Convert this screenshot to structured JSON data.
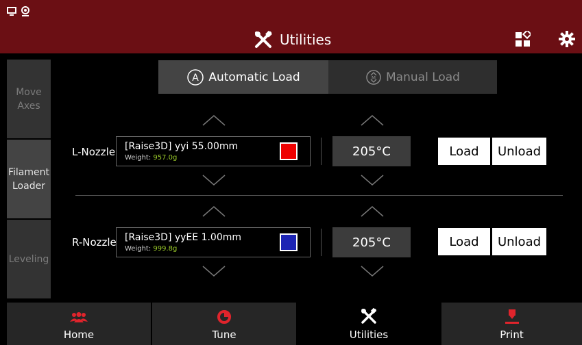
{
  "header": {
    "title": "Utilities"
  },
  "sidebar": {
    "items": [
      {
        "label": "Move\nAxes",
        "active": false
      },
      {
        "label": "Filament\nLoader",
        "active": true
      },
      {
        "label": "Leveling",
        "active": false
      }
    ]
  },
  "tabs": {
    "automatic": "Automatic Load",
    "manual": "Manual Load",
    "selected": "automatic"
  },
  "nozzles": [
    {
      "label": "L-Nozzle",
      "filament": "[Raise3D] yyi 55.00mm",
      "weight_label": "Weight: ",
      "weight_value": "957.0g",
      "color": "#ee0000",
      "temperature": "205°C",
      "load": "Load",
      "unload": "Unload"
    },
    {
      "label": "R-Nozzle",
      "filament": "[Raise3D] yyEE 1.00mm",
      "weight_label": "Weight: ",
      "weight_value": "999.8g",
      "color": "#1c24b4",
      "temperature": "205°C",
      "load": "Load",
      "unload": "Unload"
    }
  ],
  "bottom_nav": {
    "home": "Home",
    "tune": "Tune",
    "utilities": "Utilities",
    "print": "Print",
    "selected": "utilities"
  },
  "colors": {
    "header_bg": "#6b0f14",
    "accent_red": "#e0242c",
    "weight_green": "#9ccc2a"
  }
}
